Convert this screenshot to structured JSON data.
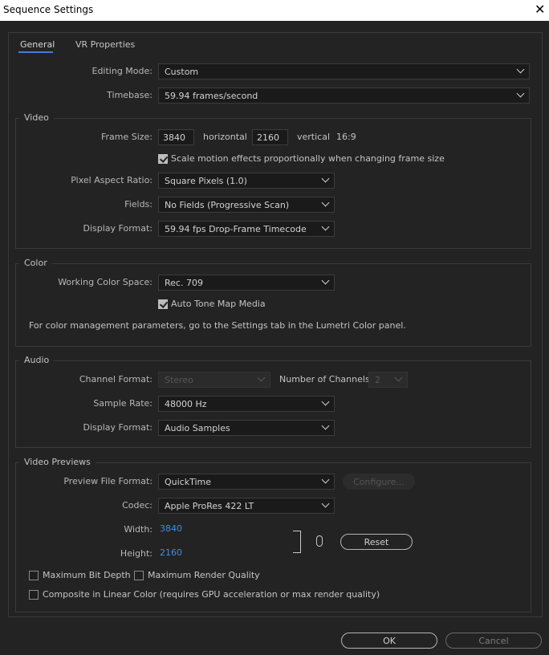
{
  "window": {
    "title": "Sequence Settings",
    "close_symbol": "✕"
  },
  "tabs": [
    {
      "label": "General",
      "active": true
    },
    {
      "label": "VR Properties",
      "active": false
    }
  ],
  "general": {
    "editing_mode_label": "Editing Mode:",
    "editing_mode_value": "Custom",
    "timebase_label": "Timebase:",
    "timebase_value": "59.94  frames/second"
  },
  "video": {
    "title": "Video",
    "frame_size_label": "Frame Size:",
    "frame_width": "3840",
    "horizontal_label": "horizontal",
    "frame_height": "2160",
    "vertical_label": "vertical",
    "aspect": "16:9",
    "scale_motion_label": "Scale motion effects proportionally when changing frame size",
    "scale_motion_checked": true,
    "pixel_aspect_label": "Pixel Aspect Ratio:",
    "pixel_aspect_value": "Square Pixels (1.0)",
    "fields_label": "Fields:",
    "fields_value": "No Fields (Progressive Scan)",
    "display_format_label": "Display Format:",
    "display_format_value": "59.94 fps Drop-Frame Timecode"
  },
  "color": {
    "title": "Color",
    "working_space_label": "Working Color Space:",
    "working_space_value": "Rec. 709",
    "auto_tone_label": "Auto Tone Map Media",
    "auto_tone_checked": true,
    "note": "For color management parameters, go to the Settings tab in the Lumetri Color panel."
  },
  "audio": {
    "title": "Audio",
    "channel_format_label": "Channel Format:",
    "channel_format_value": "Stereo",
    "num_channels_label": "Number of Channels:",
    "num_channels_value": "2",
    "sample_rate_label": "Sample Rate:",
    "sample_rate_value": "48000 Hz",
    "display_format_label": "Display Format:",
    "display_format_value": "Audio Samples"
  },
  "previews": {
    "title": "Video Previews",
    "file_format_label": "Preview File Format:",
    "file_format_value": "QuickTime",
    "configure_label": "Configure...",
    "codec_label": "Codec:",
    "codec_value": "Apple ProRes 422 LT",
    "width_label": "Width:",
    "width_value": "3840",
    "height_label": "Height:",
    "height_value": "2160",
    "reset_label": "Reset",
    "max_bit_depth_label": "Maximum Bit Depth",
    "max_bit_depth_checked": false,
    "max_render_quality_label": "Maximum Render Quality",
    "max_render_quality_checked": false,
    "linear_color_label": "Composite in Linear Color (requires GPU acceleration or max render quality)",
    "linear_color_checked": false
  },
  "footer": {
    "ok_label": "OK",
    "cancel_label": "Cancel"
  },
  "colors": {
    "accent": "#3f7fd7",
    "link_value": "#3d8ee6",
    "background": "#232323"
  }
}
